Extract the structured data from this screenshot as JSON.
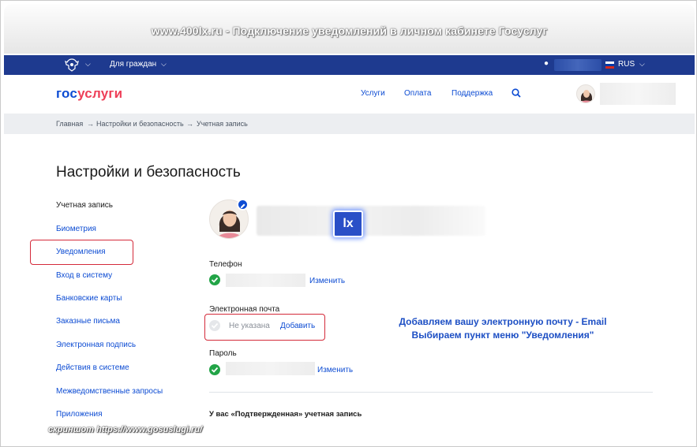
{
  "banner": {
    "title": "www.400lx.ru - Подключение уведомлений в личном кабинете Госуслуг"
  },
  "topbar": {
    "citizens": "Для граждан",
    "language": "RUS"
  },
  "header": {
    "logo_part1": "гос",
    "logo_part2": "услуги",
    "nav": [
      "Услуги",
      "Оплата",
      "Поддержка"
    ]
  },
  "breadcrumbs": [
    "Главная",
    "→",
    "Настройки и безопасность",
    "→",
    "Учетная запись"
  ],
  "page": {
    "title": "Настройки и безопасность"
  },
  "sidebar": {
    "items": [
      {
        "label": "Учетная запись"
      },
      {
        "label": "Биометрия"
      },
      {
        "label": "Уведомления"
      },
      {
        "label": "Вход в систему"
      },
      {
        "label": "Банковские карты"
      },
      {
        "label": "Заказные письма"
      },
      {
        "label": "Электронная подпись"
      },
      {
        "label": "Действия в системе"
      },
      {
        "label": "Межведомственные запросы"
      },
      {
        "label": "Приложения"
      }
    ]
  },
  "profile": {
    "watermark": "lx",
    "phone_label": "Телефон",
    "phone_action": "Изменить",
    "email_label": "Электронная почта",
    "email_value": "Не указана",
    "email_action": "Добавить",
    "password_label": "Пароль",
    "password_action": "Изменить",
    "status_text": "У вас «Подтвержденная» учетная запись"
  },
  "annotation": {
    "line1": "Добавляем вашу электронную почту - Email",
    "line2": "Выбираем пункт меню \"Уведомления\""
  },
  "footer": {
    "screenshot_credit": "скриншот https://www.gosuslugi.ru/"
  },
  "colors": {
    "brand_blue": "#0d4cd3",
    "brand_red": "#ee3f58",
    "topbar": "#1e3a8f",
    "highlight": "#d42a3a",
    "success": "#22a447"
  }
}
